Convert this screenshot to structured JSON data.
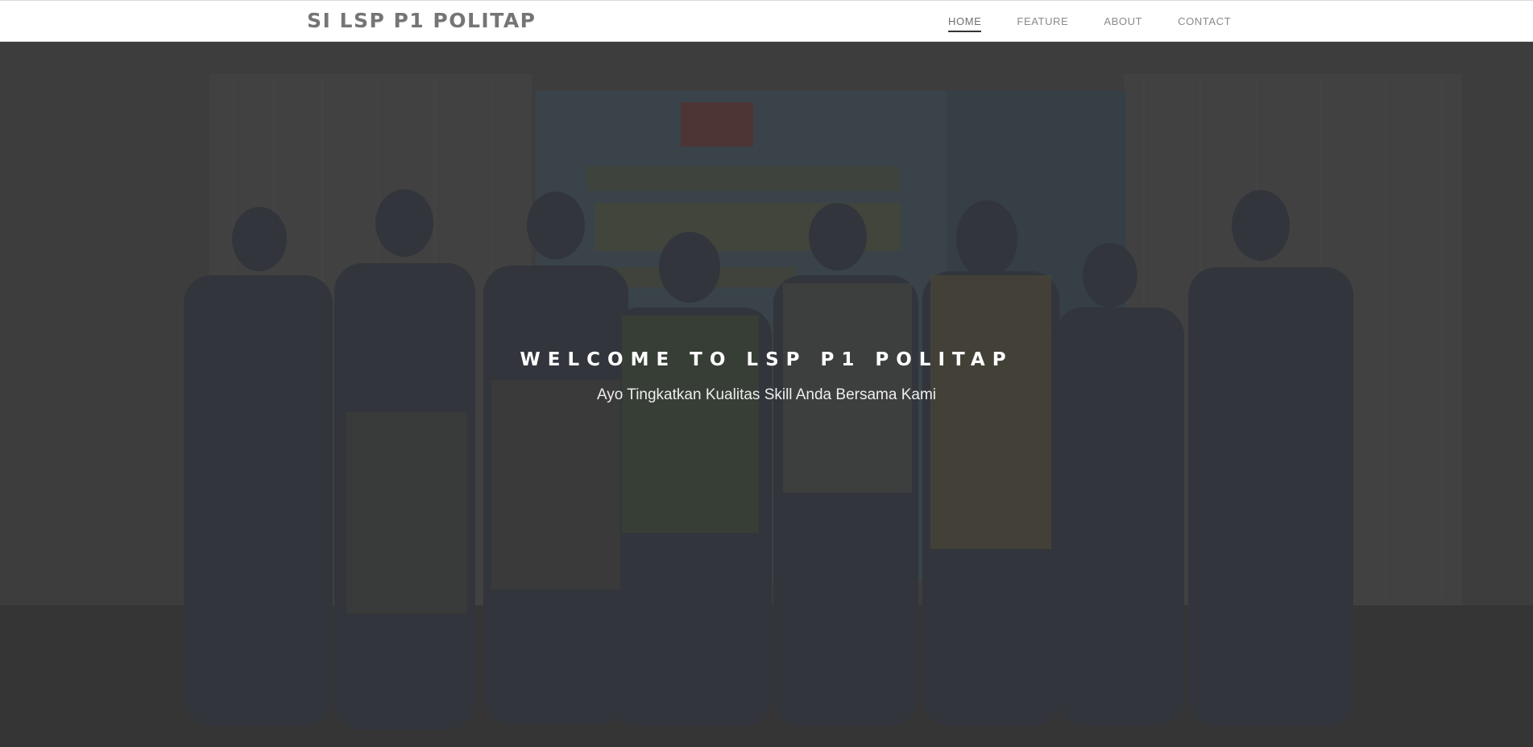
{
  "navbar": {
    "brand": "SI LSP P1 POLITAP",
    "links": [
      {
        "label": "HOME",
        "active": true
      },
      {
        "label": "FEATURE",
        "active": false
      },
      {
        "label": "ABOUT",
        "active": false
      },
      {
        "label": "CONTACT",
        "active": false
      }
    ]
  },
  "hero": {
    "title": "WELCOME TO LSP P1 POLITAP",
    "subtitle": "Ayo Tingkatkan Kualitas Skill Anda Bersama Kami",
    "background_image": "group-photo"
  },
  "colors": {
    "brand_text": "#757575",
    "nav_text": "#8a8a8a",
    "active_underline": "#333333",
    "hero_overlay": "#3d3d3d",
    "hero_text": "#ffffff"
  }
}
